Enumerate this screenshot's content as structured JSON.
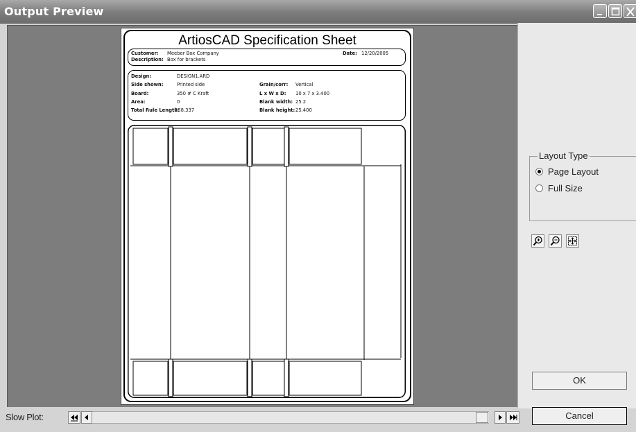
{
  "window": {
    "title": "Output Preview"
  },
  "sheet": {
    "title": "ArtiosCAD Specification Sheet",
    "header": {
      "customer_label": "Customer:",
      "customer": "Meeber Box Company",
      "description_label": "Description:",
      "description": "Box for brackets",
      "date_label": "Date:",
      "date": "12/20/2005"
    },
    "spec": {
      "design_label": "Design:",
      "design": "DESIGN1.ARD",
      "side_label": "Side shown:",
      "side": "Printed side",
      "board_label": "Board:",
      "board": "350 # C Kraft",
      "area_label": "Area:",
      "area": "0",
      "rule_label": "Total Rule Length:",
      "rule": "258.337",
      "grain_label": "Grain/corr:",
      "grain": "Vertical",
      "lwd_label": "L x W x D:",
      "lwd": "10 x 7 x 3.400",
      "bw_label": "Blank width:",
      "bw": "25.2",
      "bh_label": "Blank height:",
      "bh": "25.400"
    }
  },
  "layout_type": {
    "legend": "Layout Type",
    "options": [
      {
        "label": "Page Layout",
        "selected": true
      },
      {
        "label": "Full Size",
        "selected": false
      }
    ]
  },
  "tools": [
    "zoom-in-icon",
    "zoom-out-icon",
    "fit-to-window-icon"
  ],
  "buttons": {
    "ok": "OK",
    "cancel": "Cancel"
  },
  "slow_plot": {
    "label": "Slow Plot:"
  }
}
